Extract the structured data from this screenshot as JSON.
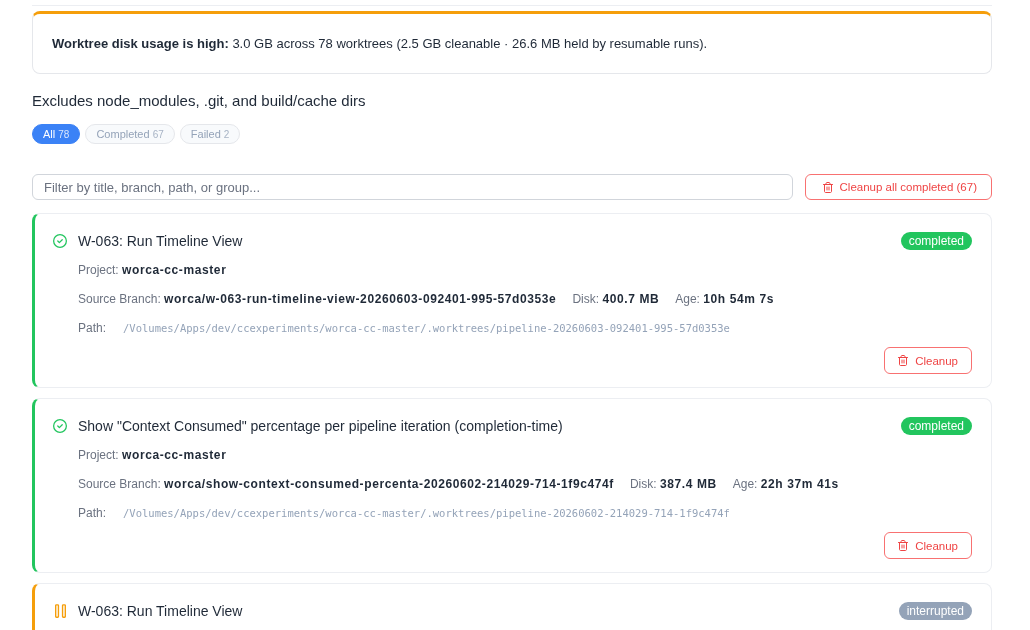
{
  "banner": {
    "text": "**Worktree disk usage is high:** 3.0 GB across 78 worktrees (2.5 GB cleanable · 26.6 MB held by resumable runs)."
  },
  "note": "Excludes node_modules, .git, and build/cache dirs",
  "filters": [
    {
      "label": "All",
      "count": "78",
      "selected": true
    },
    {
      "label": "Completed",
      "count": "67",
      "selected": false
    },
    {
      "label": "Failed",
      "count": "2",
      "selected": false
    }
  ],
  "search": {
    "placeholder": "Filter by title, branch, path, or group..."
  },
  "cleanup_all_button": {
    "label": "Cleanup all completed (67)"
  },
  "worktrees": [
    {
      "kind": "completed",
      "title": "W-063: Run Timeline View",
      "status": "completed",
      "detail_rows": [
        {
          "fields": [
            {
              "label": "Project:",
              "value": "worca-cc-master"
            }
          ]
        },
        {
          "fields": [
            {
              "label": "Source Branch:",
              "value": "worca/w-063-run-timeline-view-20260603-092401-995-57d0353e"
            },
            {
              "label": "Disk:",
              "value": "400.7 MB"
            },
            {
              "label": "Age:",
              "value": "10h 54m 7s"
            }
          ]
        }
      ],
      "path": {
        "label": "Path:",
        "value": "/Volumes/Apps/dev/ccexperiments/worca-cc-master/.worktrees/pipeline-20260603-092401-995-57d0353e"
      },
      "button": "Cleanup"
    },
    {
      "kind": "completed",
      "title": "Show \"Context Consumed\" percentage per pipeline iteration (completion-time)",
      "status": "completed",
      "detail_rows": [
        {
          "fields": [
            {
              "label": "Project:",
              "value": "worca-cc-master"
            }
          ]
        },
        {
          "fields": [
            {
              "label": "Source Branch:",
              "value": "worca/show-context-consumed-percenta-20260602-214029-714-1f9c474f"
            },
            {
              "label": "Disk:",
              "value": "387.4 MB"
            },
            {
              "label": "Age:",
              "value": "22h 37m 41s"
            }
          ]
        }
      ],
      "path": {
        "label": "Path:",
        "value": "/Volumes/Apps/dev/ccexperiments/worca-cc-master/.worktrees/pipeline-20260602-214029-714-1f9c474f"
      },
      "button": "Cleanup"
    },
    {
      "kind": "interrupted",
      "title": "W-063: Run Timeline View",
      "status": "interrupted"
    }
  ]
}
